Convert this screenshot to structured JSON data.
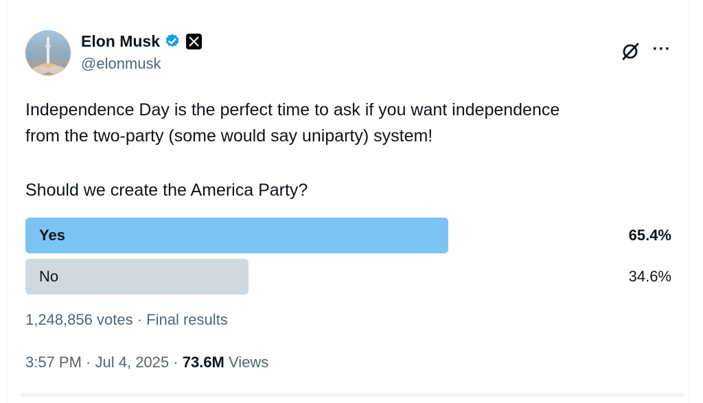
{
  "author": {
    "name": "Elon Musk",
    "handle": "@elonmusk",
    "verified": true,
    "affiliation_badge": "x-logo-icon"
  },
  "header_actions": {
    "grok_icon": "grok-icon",
    "more_icon": "more-options-icon",
    "more_label": "···"
  },
  "tweet": {
    "text_line1": "Independence Day is the perfect time to ask if you want independence",
    "text_line2": "from the two-party (some would say uniparty) system!",
    "question": "Should we create the America Party?"
  },
  "poll": {
    "options": [
      {
        "label": "Yes",
        "percent": 65.4,
        "percent_text": "65.4%",
        "winner": true,
        "bar_color": "#7cc3f5"
      },
      {
        "label": "No",
        "percent": 34.6,
        "percent_text": "34.6%",
        "winner": false,
        "bar_color": "#cfd9de"
      }
    ],
    "votes_text": "1,248,856 votes",
    "separator": " · ",
    "status_text": "Final results"
  },
  "meta": {
    "time": "3:57 PM",
    "separator": " · ",
    "date": "Jul 4, 2025",
    "separator2": " · ",
    "views_count": "73.6M",
    "views_label": " Views"
  },
  "colors": {
    "verified_blue": "#1d9bf0",
    "text_primary": "#0f1419",
    "text_secondary": "#536471"
  }
}
